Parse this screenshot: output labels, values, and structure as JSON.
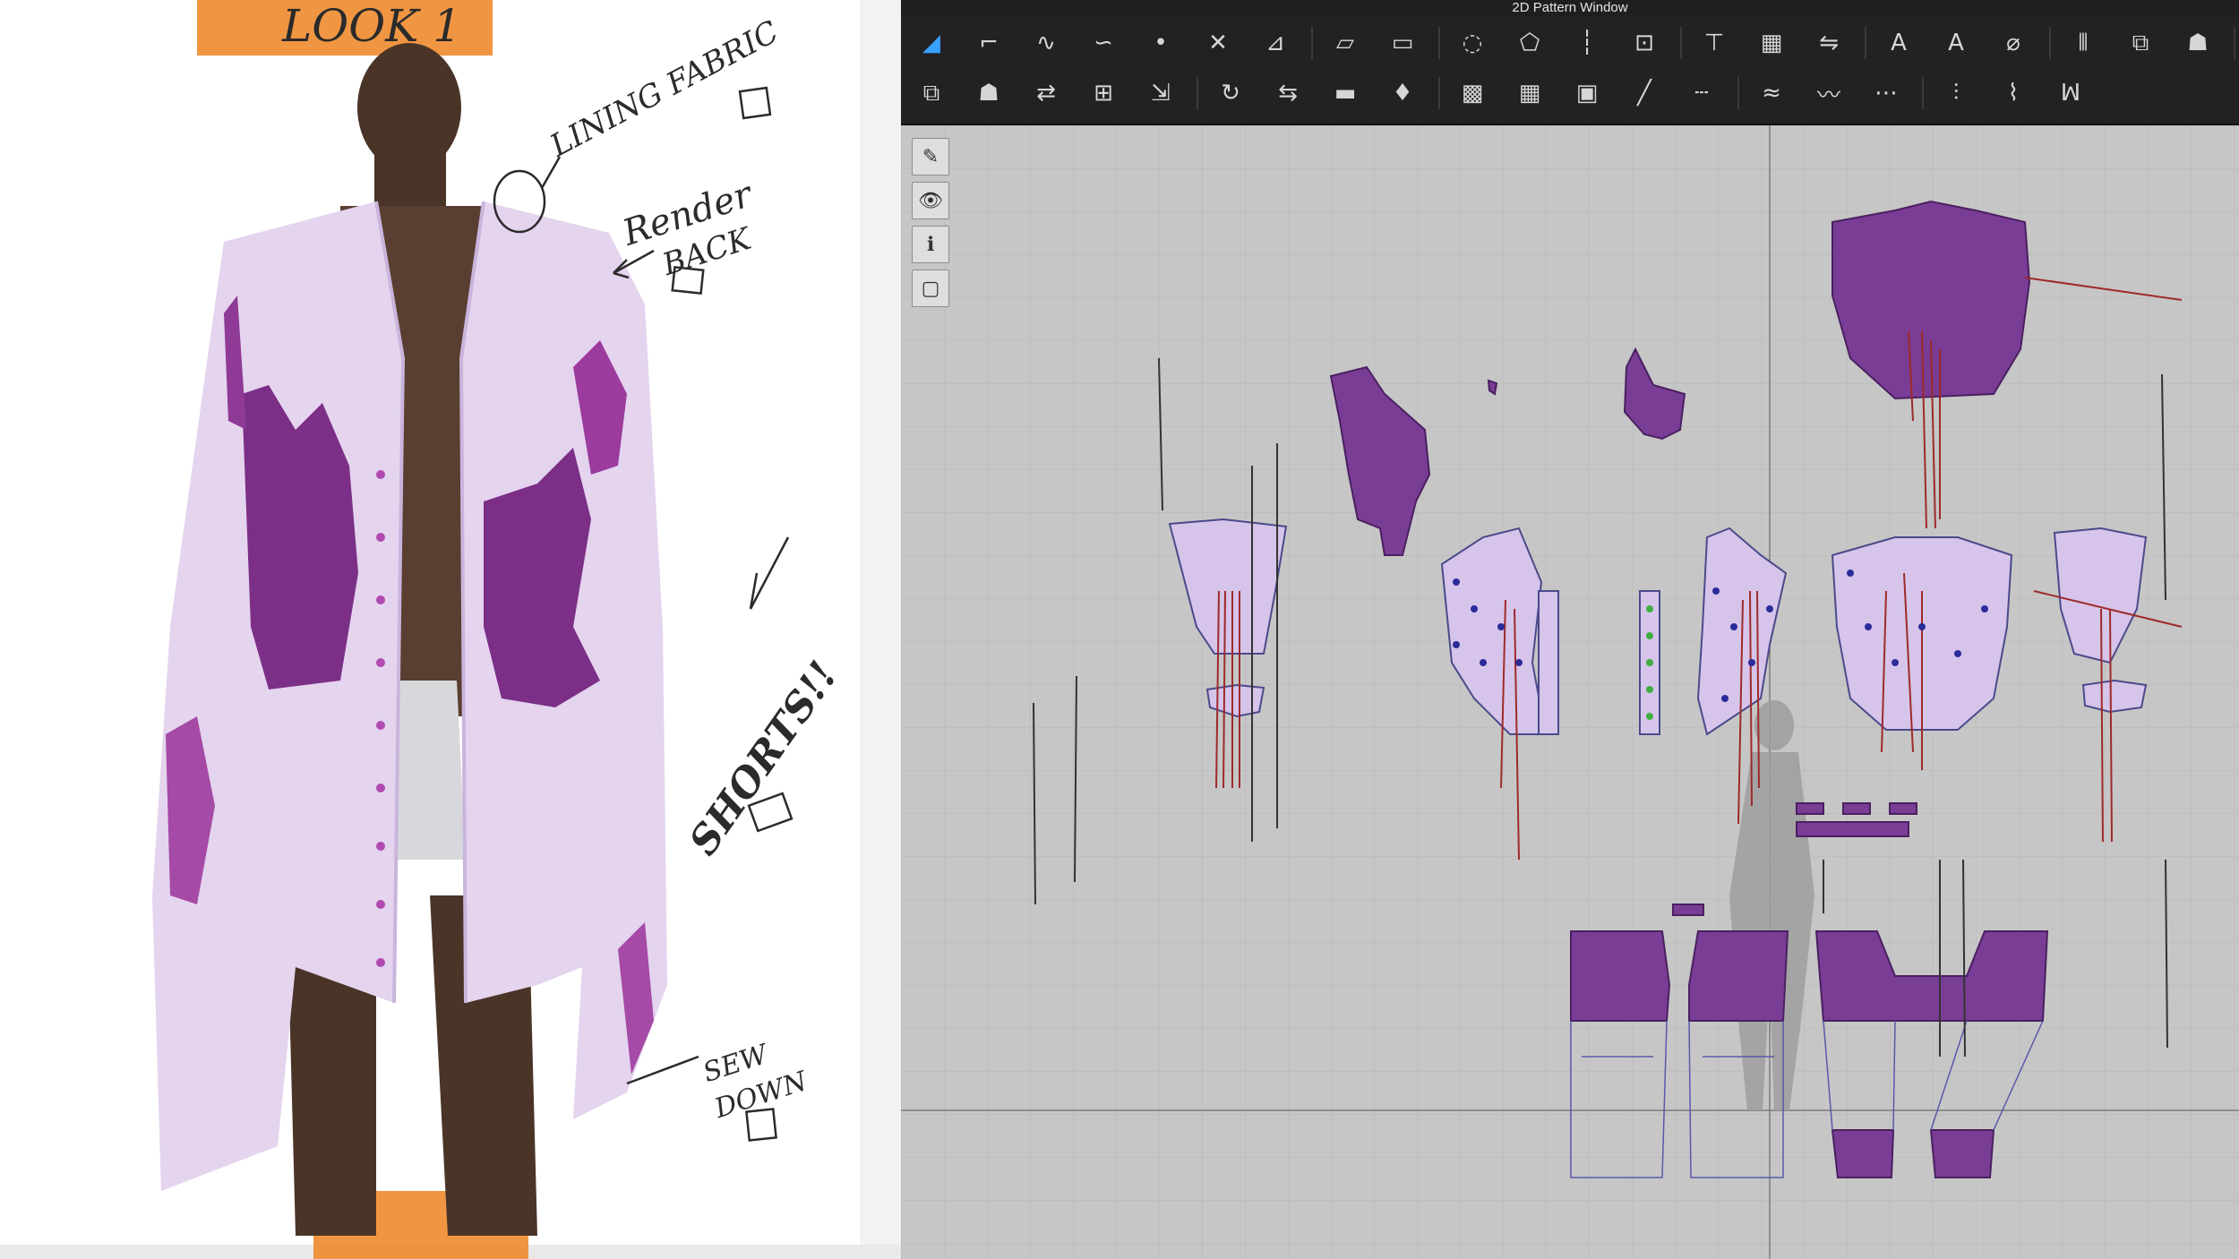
{
  "sketch": {
    "title_tape": "LOOK 1",
    "notes": {
      "lining_fabric": "LINING FABRIC",
      "render": "Render",
      "back": "BACK",
      "shorts": "SHORTS!!",
      "sew_down": "SEW DOWN"
    }
  },
  "app": {
    "window_title": "2D Pattern Window",
    "toolbar_row1": [
      "segment-select-icon",
      "edit-point-icon",
      "curve-point-icon",
      "edit-curvature-icon",
      "add-point-icon",
      "cut-curve-icon",
      "slash-spread-icon",
      "polygon-icon",
      "rectangle-icon",
      "ellipse-icon",
      "internal-polygon-icon",
      "internal-line-icon",
      "trace-icon",
      "notch-icon",
      "grading-icon",
      "symmetry-icon",
      "text-icon",
      "sewing-label-icon",
      "measure-icon",
      "fold-icon",
      "seam-allowance-icon",
      "avatar-icon",
      "arrange-icon"
    ],
    "toolbar_row2": [
      "transform-pattern-icon",
      "unfold-icon",
      "rotate-pattern-icon",
      "flip-pattern-icon",
      "steam-icon",
      "garment-icon",
      "fabric-icon",
      "texture-icon",
      "graphic-icon",
      "line-sewing-icon",
      "dashed-sewing-icon",
      "free-sewing-icon",
      "trim-sewing-icon",
      "edit-sewing-icon",
      "elastic-icon",
      "shirring-icon",
      "zigzag-icon",
      "topstitch-icon",
      "button-icon",
      "buttonhole-icon"
    ],
    "side_tools": [
      "brush-icon",
      "garment-view-icon",
      "info-icon",
      "pattern-view-icon"
    ],
    "colors": {
      "fabric_purple": "#7a3d96",
      "lining_lilac": "#d8c6ec",
      "seam_red": "#9e2a2a",
      "point_blue": "#2b2b9a",
      "grid_bg": "#c6c6c6"
    }
  }
}
